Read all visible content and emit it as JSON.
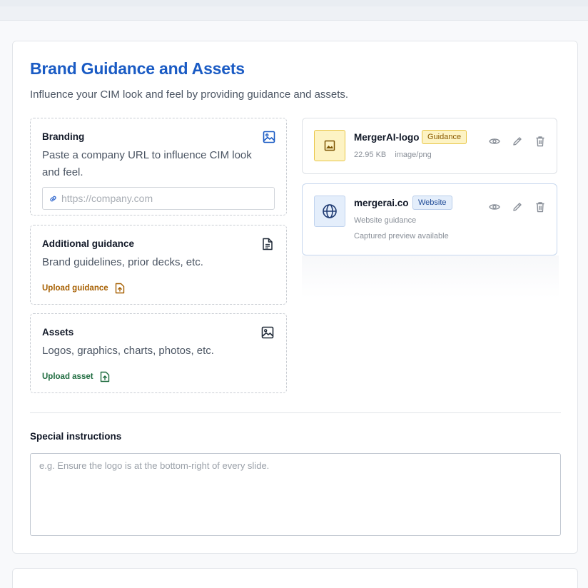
{
  "section": {
    "title": "Brand Guidance and Assets",
    "subtitle": "Influence your CIM look and feel by providing guidance and assets."
  },
  "branding": {
    "title": "Branding",
    "description_line1": "Paste a company URL to influence CIM look",
    "description_line2": "and feel.",
    "url_placeholder": "https://company.com",
    "url_value": "",
    "icon": "image-icon"
  },
  "guidance": {
    "title": "Additional guidance",
    "description": "Brand guidelines, prior decks, etc.",
    "upload_label": "Upload guidance",
    "icon": "document-icon"
  },
  "assets": {
    "title": "Assets",
    "description": "Logos, graphics, charts, photos, etc.",
    "upload_label": "Upload asset",
    "icon": "image-icon"
  },
  "items": [
    {
      "name": "MergerAI-logo",
      "badge": "Guidance",
      "size": "22.95 KB",
      "type": "image/png",
      "icon": "image-icon"
    },
    {
      "name": "mergerai.co",
      "badge": "Website",
      "meta1": "Website guidance",
      "meta2": "Captured preview available",
      "icon": "globe-icon"
    }
  ],
  "special_instructions": {
    "label": "Special instructions",
    "placeholder": "e.g. Ensure the logo is at the bottom-right of every slide.",
    "value": ""
  },
  "colors": {
    "title": "#1a5bc4",
    "guidance_accent": "#a65f00",
    "asset_accent": "#1d6b3e",
    "badge_guidance_bg": "#fdf3c4",
    "badge_website_bg": "#e4eefb"
  }
}
